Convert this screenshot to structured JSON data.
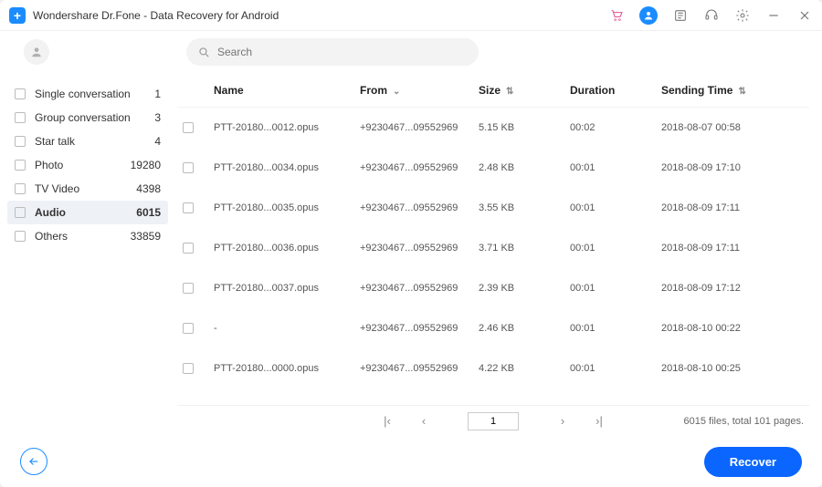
{
  "window": {
    "title": "Wondershare Dr.Fone - Data Recovery for Android"
  },
  "search": {
    "placeholder": "Search"
  },
  "sidebar": {
    "items": [
      {
        "label": "Single conversation",
        "count": "1",
        "active": false
      },
      {
        "label": "Group conversation",
        "count": "3",
        "active": false
      },
      {
        "label": "Star talk",
        "count": "4",
        "active": false
      },
      {
        "label": "Photo",
        "count": "19280",
        "active": false
      },
      {
        "label": "TV Video",
        "count": "4398",
        "active": false
      },
      {
        "label": "Audio",
        "count": "6015",
        "active": true
      },
      {
        "label": "Others",
        "count": "33859",
        "active": false
      }
    ]
  },
  "table": {
    "headers": {
      "name": "Name",
      "from": "From",
      "size": "Size",
      "duration": "Duration",
      "time": "Sending Time"
    },
    "rows": [
      {
        "name": "PTT-20180...0012.opus",
        "from": "+9230467...09552969",
        "size": "5.15 KB",
        "duration": "00:02",
        "time": "2018-08-07 00:58"
      },
      {
        "name": "PTT-20180...0034.opus",
        "from": "+9230467...09552969",
        "size": "2.48 KB",
        "duration": "00:01",
        "time": "2018-08-09 17:10"
      },
      {
        "name": "PTT-20180...0035.opus",
        "from": "+9230467...09552969",
        "size": "3.55 KB",
        "duration": "00:01",
        "time": "2018-08-09 17:11"
      },
      {
        "name": "PTT-20180...0036.opus",
        "from": "+9230467...09552969",
        "size": "3.71 KB",
        "duration": "00:01",
        "time": "2018-08-09 17:11"
      },
      {
        "name": "PTT-20180...0037.opus",
        "from": "+9230467...09552969",
        "size": "2.39 KB",
        "duration": "00:01",
        "time": "2018-08-09 17:12"
      },
      {
        "name": "-",
        "from": "+9230467...09552969",
        "size": "2.46 KB",
        "duration": "00:01",
        "time": "2018-08-10 00:22"
      },
      {
        "name": "PTT-20180...0000.opus",
        "from": "+9230467...09552969",
        "size": "4.22 KB",
        "duration": "00:01",
        "time": "2018-08-10 00:25"
      }
    ]
  },
  "pager": {
    "page": "1",
    "info": "6015 files, total 101 pages."
  },
  "footer": {
    "recover": "Recover"
  }
}
